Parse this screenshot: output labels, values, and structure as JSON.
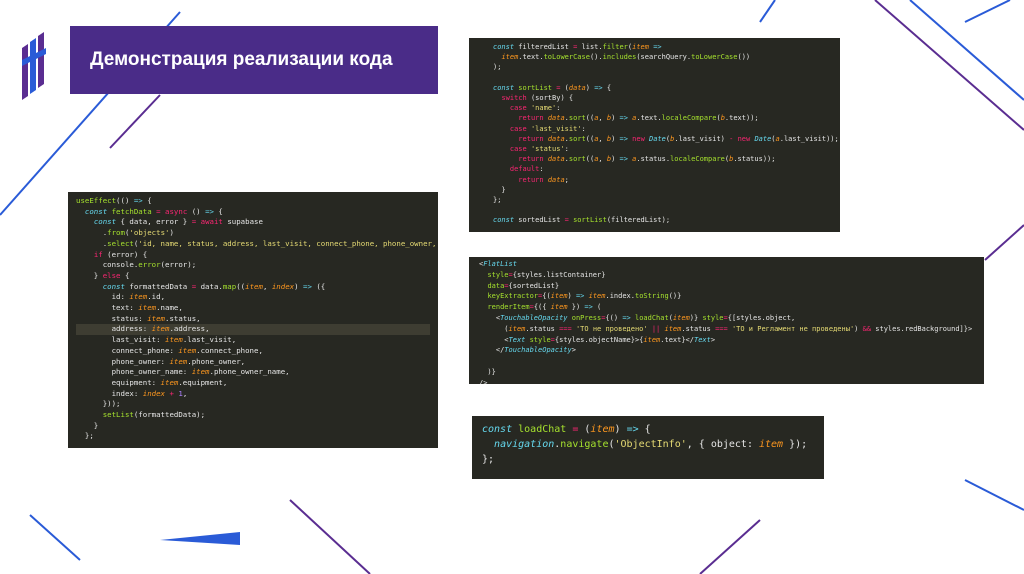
{
  "header": {
    "title": "Демонстрация реализации кода"
  },
  "colors": {
    "banner": "#4a2c88",
    "code_background": "#272822",
    "decor_blue": "#2a5bd7",
    "decor_purple": "#5a2d91"
  },
  "logo": {
    "icon": "brand-logo-icon"
  },
  "code_blocks": {
    "filter_sort": [
      "const filteredList = list.filter(item =>",
      "  item.text.toLowerCase().includes(searchQuery.toLowerCase())",
      ");",
      "",
      "const sortList = (data) => {",
      "  switch (sortBy) {",
      "    case 'name':",
      "      return data.sort((a, b) => a.text.localeCompare(b.text));",
      "    case 'last_visit':",
      "      return data.sort((a, b) => new Date(b.last_visit) - new Date(a.last_visit));",
      "    case 'status':",
      "      return data.sort((a, b) => a.status.localeCompare(b.status));",
      "    default:",
      "      return data;",
      "  }",
      "};",
      "",
      "const sortedList = sortList(filteredList);"
    ],
    "use_effect": [
      "useEffect(() => {",
      "  const fetchData = async () => {",
      "    const { data, error } = await supabase",
      "      .from('objects')",
      "      .select('id, name, status, address, last_visit, connect_phone, phone_owner,",
      "    if (error) {",
      "      console.error(error);",
      "    } else {",
      "      const formattedData = data.map((item, index) => ({",
      "        id: item.id,",
      "        text: item.name,",
      "        status: item.status,",
      "        address: item.address,",
      "        last_visit: item.last_visit,",
      "        connect_phone: item.connect_phone,",
      "        phone_owner: item.phone_owner,",
      "        phone_owner_name: item.phone_owner_name,",
      "        equipment: item.equipment,",
      "        index: index + 1,",
      "      }));",
      "      setList(formattedData);",
      "    }",
      "  };"
    ],
    "flat_list": [
      "<FlatList",
      "  style={styles.listContainer}",
      "  data={sortedList}",
      "  keyExtractor={(item) => item.index.toString()}",
      "  renderItem={({ item }) => (",
      "    <TouchableOpacity onPress={() => loadChat(item)} style={[styles.object,",
      "      (item.status === 'ТО не проведено' || item.status === 'ТО и Регламент не проведены') && styles.redBackground]}>",
      "      <Text style={styles.objectName}>{item.text}</Text>",
      "    </TouchableOpacity>",
      "",
      "  )}",
      "/>"
    ],
    "load_chat": [
      "const loadChat = (item) => {",
      "  navigation.navigate('ObjectInfo', { object: item });",
      "};"
    ]
  }
}
